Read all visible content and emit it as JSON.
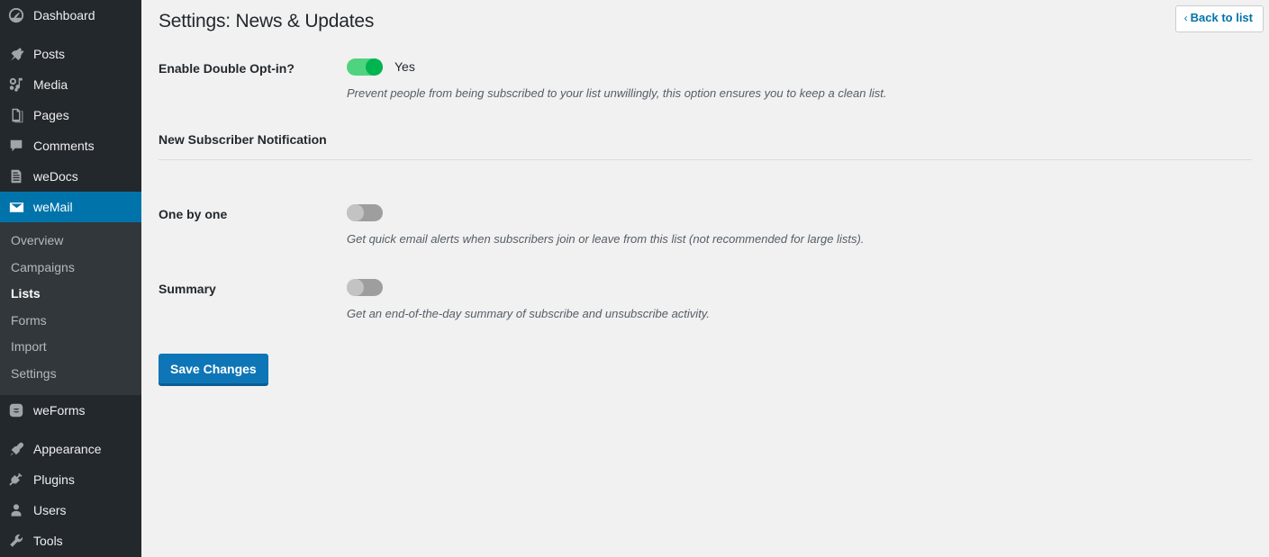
{
  "sidebar": {
    "items": [
      {
        "label": "Dashboard",
        "icon": "dashboard-icon",
        "sep_after": true
      },
      {
        "label": "Posts",
        "icon": "pin-icon",
        "sep_after": false
      },
      {
        "label": "Media",
        "icon": "media-icon",
        "sep_after": false
      },
      {
        "label": "Pages",
        "icon": "pages-icon",
        "sep_after": false
      },
      {
        "label": "Comments",
        "icon": "comments-icon",
        "sep_after": false
      },
      {
        "label": "weDocs",
        "icon": "document-icon",
        "sep_after": false
      },
      {
        "label": "weMail",
        "icon": "envelope-icon",
        "sep_after": false,
        "active": true
      }
    ],
    "submenu": [
      {
        "label": "Overview",
        "current": false
      },
      {
        "label": "Campaigns",
        "current": false
      },
      {
        "label": "Lists",
        "current": true
      },
      {
        "label": "Forms",
        "current": false
      },
      {
        "label": "Import",
        "current": false
      },
      {
        "label": "Settings",
        "current": false
      }
    ],
    "items_after": [
      {
        "label": "weForms",
        "icon": "weforms-icon",
        "sep_after": true
      },
      {
        "label": "Appearance",
        "icon": "paintbrush-icon",
        "sep_after": false
      },
      {
        "label": "Plugins",
        "icon": "plugin-icon",
        "sep_after": false
      },
      {
        "label": "Users",
        "icon": "user-icon",
        "sep_after": false
      },
      {
        "label": "Tools",
        "icon": "wrench-icon",
        "sep_after": false
      }
    ]
  },
  "header": {
    "title": "Settings: News & Updates",
    "back_button": "Back to list",
    "back_chevron": "‹"
  },
  "form": {
    "double_optin": {
      "label": "Enable Double Opt-in?",
      "toggle_state": "on",
      "toggle_text": "Yes",
      "description": "Prevent people from being subscribed to your list unwillingly, this option ensures you to keep a clean list."
    },
    "section_title": "New Subscriber Notification",
    "one_by_one": {
      "label": "One by one",
      "toggle_state": "off",
      "description": "Get quick email alerts when subscribers join or leave from this list (not recommended for large lists)."
    },
    "summary": {
      "label": "Summary",
      "toggle_state": "off",
      "description": "Get an end-of-the-day summary of subscribe and unsubscribe activity."
    },
    "save_button": "Save Changes"
  },
  "colors": {
    "sidebar_bg": "#23282d",
    "submenu_bg": "#32373c",
    "accent_blue": "#0073aa",
    "button_blue": "#0e76b7",
    "toggle_on_track": "#4fd37e",
    "toggle_on_knob": "#00b44f",
    "toggle_off_track": "#9e9e9e",
    "toggle_off_knob": "#c3c3c3",
    "content_bg": "#f1f1f1"
  }
}
